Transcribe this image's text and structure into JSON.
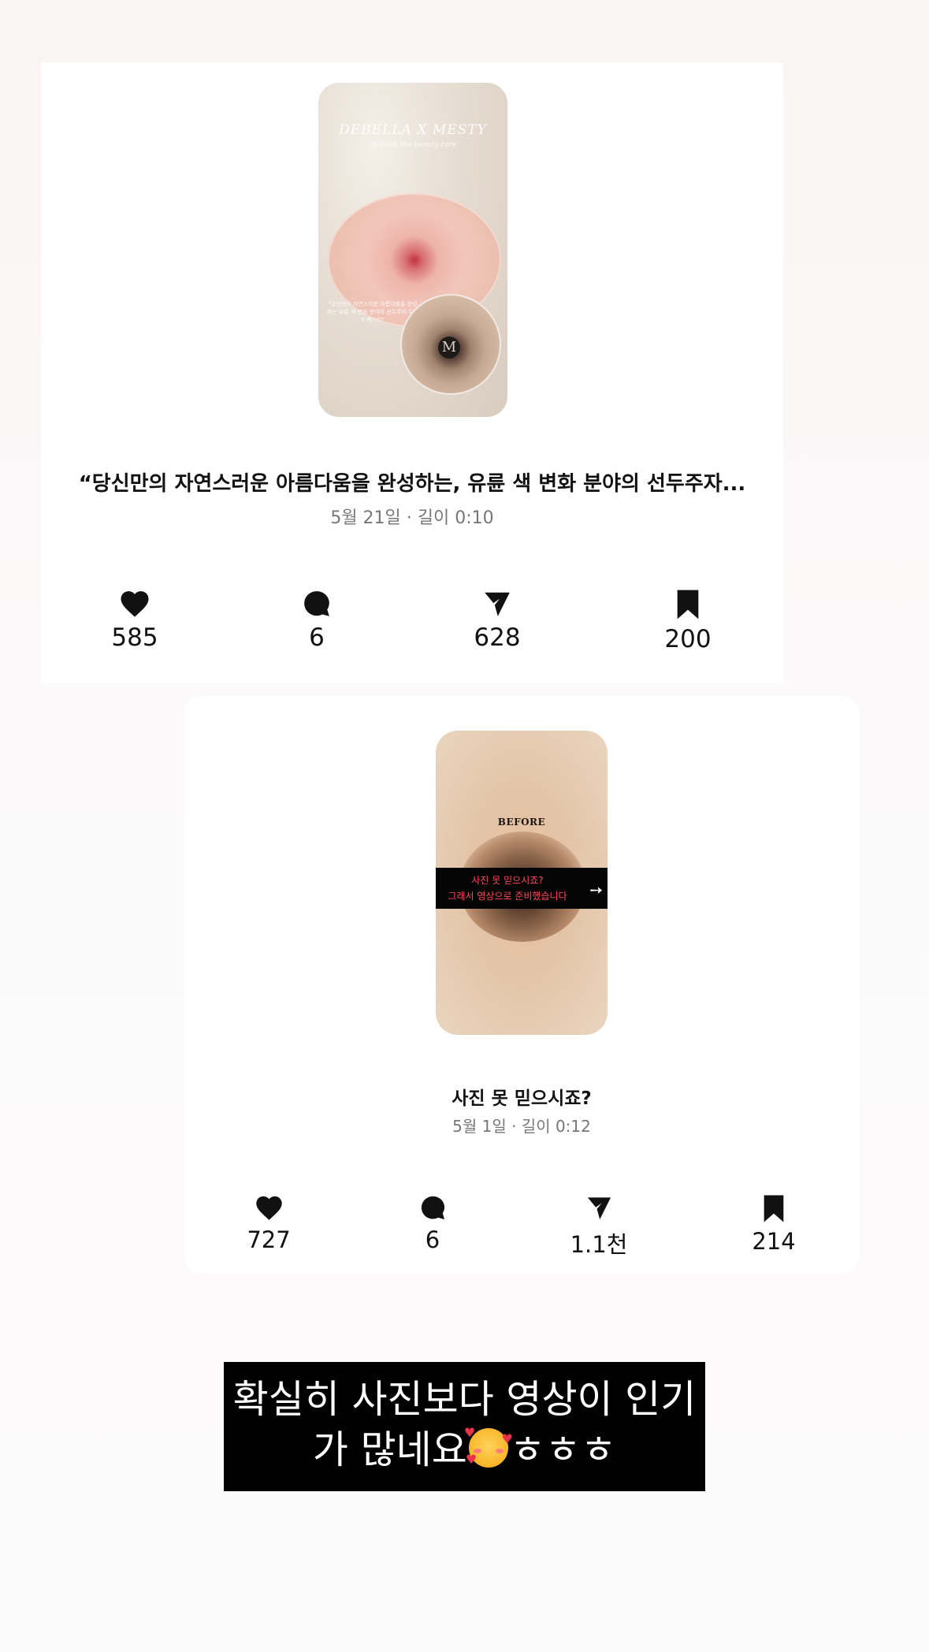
{
  "posts": [
    {
      "thumbnail": {
        "brand": "DEBELLA X MESTY",
        "brand_sub": "re:think the beauty care",
        "logo_letter": "M",
        "small_copy": "\"당신만의 자연스러운 아름다움을 완성하는 유륜 색 변화 분야의 선두주자 두엠 X 메스티\""
      },
      "title": "“당신만의 자연스러운 아름다움을 완성하는, 유륜 색 변화 분야의 선두주자...",
      "meta": "5월 21일 · 길이 0:10",
      "stats": {
        "likes": "585",
        "comments": "6",
        "shares": "628",
        "saves": "200"
      }
    },
    {
      "thumbnail": {
        "before_label": "BEFORE",
        "overlay_line1": "사진 못 믿으시죠?",
        "overlay_line2": "그래서 영상으로 준비했습니다"
      },
      "title": "사진 못 믿으시죠?",
      "meta": "5월 1일 · 길이 0:12",
      "stats": {
        "likes": "727",
        "comments": "6",
        "shares": "1.1천",
        "saves": "214"
      }
    }
  ],
  "caption": {
    "line1": "확실히 사진보다 영상이 인기",
    "line2_text": "가 많네요",
    "line2_emoji": "smiling-face-with-hearts",
    "line2_suffix": "ㅎㅎㅎ"
  },
  "icons": {
    "like": "heart-icon",
    "comment": "comment-bubble-icon",
    "share": "paper-plane-icon",
    "save": "bookmark-icon"
  },
  "colors": {
    "overlay_text": "#ff4957",
    "caption_bg": "#000000",
    "meta_text": "#777777"
  }
}
